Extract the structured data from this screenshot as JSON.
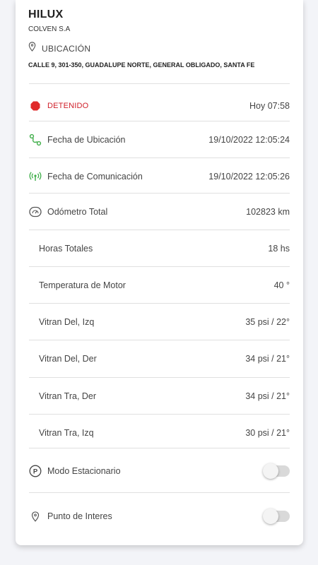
{
  "vehicle": {
    "name": "HILUX",
    "company": "COLVEN S.A"
  },
  "location": {
    "label": "UBICACIÓN",
    "address": "CALLE 9, 301-350, GUADALUPE NORTE, GENERAL OBLIGADO, SANTA FE"
  },
  "status": {
    "label": "DETENIDO",
    "value": "Hoy 07:58",
    "color": "#e02b2b"
  },
  "rows": [
    {
      "label": "Fecha de Ubicación",
      "value": "19/10/2022 12:05:24",
      "icon": "route-icon"
    },
    {
      "label": "Fecha de Comunicación",
      "value": "19/10/2022 12:05:26",
      "icon": "signal-icon"
    },
    {
      "label": "Odómetro Total",
      "value": "102823 km",
      "icon": "speedometer-icon"
    },
    {
      "label": "Horas Totales",
      "value": "18 hs"
    },
    {
      "label": "Temperatura de Motor",
      "value": "40 °"
    },
    {
      "label": "Vitran Del, Izq",
      "value": "35 psi / 22°"
    },
    {
      "label": "Vitran Del, Der",
      "value": "34 psi / 21°"
    },
    {
      "label": "Vitran Tra, Der",
      "value": "34 psi / 21°"
    },
    {
      "label": "Vitran Tra, Izq",
      "value": "30 psi / 21°"
    }
  ],
  "toggles": [
    {
      "label": "Modo Estacionario",
      "icon": "parking-icon",
      "on": false
    },
    {
      "label": "Punto de Interes",
      "icon": "location-pin-icon",
      "on": false
    }
  ],
  "colors": {
    "accent_green": "#3fae49",
    "status_red": "#e02b2b"
  }
}
